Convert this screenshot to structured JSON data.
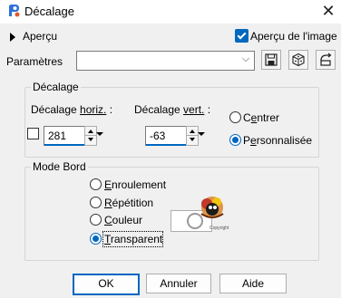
{
  "window": {
    "title": "Décalage",
    "close_glyph": "✕",
    "app_icon": "paint-shop-pro-icon"
  },
  "preview": {
    "toggle_label": "Aperçu",
    "preview_on_image_label": "Aperçu de l'image",
    "preview_on_image_checked": true
  },
  "presets": {
    "label": "Paramètres",
    "value": "",
    "chevron": "⌵",
    "tools": [
      "save-preset-icon",
      "randomize-icon",
      "reset-icon"
    ]
  },
  "offset": {
    "group_label": "Décalage",
    "horiz_label_pre": "Décalage ",
    "horiz_label_key": "horiz.",
    "horiz_label_post": " :",
    "horiz_value": "281",
    "vert_label_pre": "Décalage ",
    "vert_label_key": "vert.",
    "vert_label_post": " :",
    "vert_value": "-63",
    "lock_checked": false,
    "center_label_pre": "C",
    "center_label_key": "e",
    "center_label_post": "ntrer",
    "custom_label_pre": "P",
    "custom_label_key": "e",
    "custom_label_post": "rsonnalisée",
    "selected": "custom"
  },
  "edge_mode": {
    "group_label": "Mode Bord",
    "options": [
      {
        "id": "wrap",
        "key": "E",
        "rest": "nroulement"
      },
      {
        "id": "repeat",
        "key": "R",
        "rest": "épétition"
      },
      {
        "id": "color",
        "key": "C",
        "rest": "ouleur"
      },
      {
        "id": "transparent",
        "key": "T",
        "rest": "ransparent"
      }
    ],
    "selected": "transparent",
    "watermark_caption": "Copyright"
  },
  "buttons": {
    "ok": "OK",
    "cancel": "Annuler",
    "help": "Aide"
  },
  "colors": {
    "accent": "#0067c0",
    "background": "#f0f0f0",
    "border": "#adadad"
  }
}
